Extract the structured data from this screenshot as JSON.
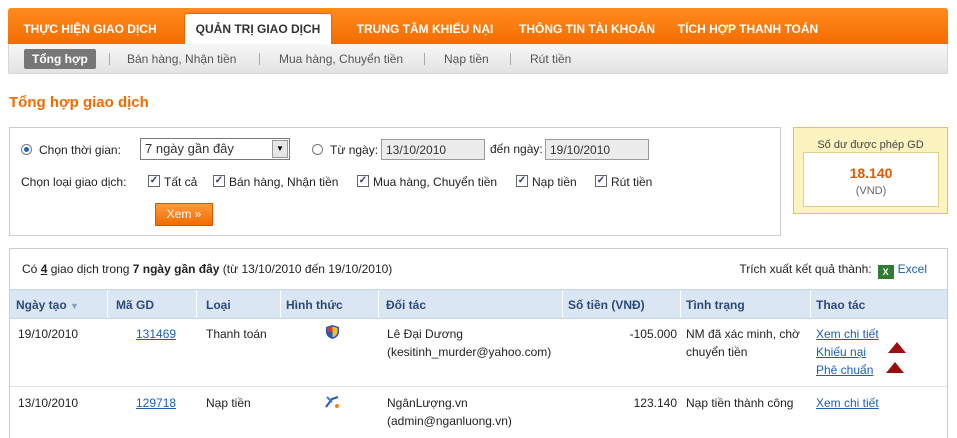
{
  "nav": {
    "tabs": [
      {
        "label": "THỰC HIỆN GIAO DỊCH"
      },
      {
        "label": "QUẢN TRỊ GIAO DỊCH"
      },
      {
        "label": "TRUNG TÂM KHIẾU NẠI"
      },
      {
        "label": "THÔNG TIN TÀI KHOẢN"
      },
      {
        "label": "TÍCH HỢP THANH TOÁN"
      }
    ],
    "subtabs": [
      {
        "label": "Tổng hợp"
      },
      {
        "label": "Bán hàng, Nhận tiền"
      },
      {
        "label": "Mua hàng, Chuyển tiền"
      },
      {
        "label": "Nạp tiền"
      },
      {
        "label": "Rút tiền"
      }
    ]
  },
  "page": {
    "title": "Tổng hợp giao dịch"
  },
  "filter": {
    "period_label": "Chọn thời gian:",
    "period_value": "7 ngày gần đây",
    "from_label": "Từ ngày:",
    "from_value": "13/10/2010",
    "to_label": "đến ngày:",
    "to_value": "19/10/2010",
    "type_label": "Chọn loại giao dịch:",
    "types": [
      {
        "label": "Tất cả"
      },
      {
        "label": "Bán hàng, Nhận tiền"
      },
      {
        "label": "Mua hàng, Chuyển tiền"
      },
      {
        "label": "Nạp tiền"
      },
      {
        "label": "Rút tiền"
      }
    ],
    "submit_label": "Xem »"
  },
  "balance": {
    "title": "Số dư được phép GD",
    "amount": "18.140",
    "currency": "(VND)"
  },
  "results": {
    "summary_prefix": "Có ",
    "count": "4",
    "summary_mid": " giao dịch trong ",
    "period": "7 ngày gần đây",
    "summary_suffix": " (từ 13/10/2010 đến 19/10/2010)",
    "export_label": "Trích xuất kết quả thành:",
    "export_link": "Excel",
    "headers": {
      "date": "Ngày tạo",
      "id": "Mã GD",
      "type": "Loại",
      "method": "Hình thức",
      "partner": "Đối tác",
      "amount": "Số tiền (VNĐ)",
      "status": "Tình trạng",
      "actions": "Thao tác"
    },
    "rows": [
      {
        "date": "19/10/2010",
        "id": "131469",
        "type": "Thanh toán",
        "partner_name": "Lê Đại Dương",
        "partner_email": "(kesitinh_murder@yahoo.com)",
        "amount": "-105.000",
        "status_line1": "NM đã xác minh, chờ",
        "status_line2": "chuyển tiền",
        "action1": "Xem chi tiết",
        "action2": "Khiếu nại",
        "action3": "Phê chuẩn"
      },
      {
        "date": "13/10/2010",
        "id": "129718",
        "type": "Nạp tiền",
        "partner_name": "NgânLượng.vn",
        "partner_email": "(admin@nganluong.vn)",
        "amount": "123.140",
        "status_line1": "Nạp tiền thành công",
        "action1": "Xem chi tiết"
      }
    ]
  }
}
